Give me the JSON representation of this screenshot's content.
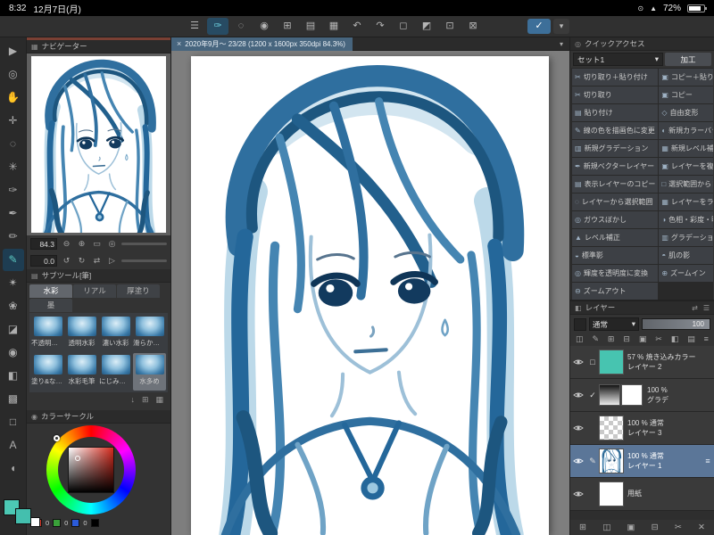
{
  "colors": {
    "main_color": "#4cc8b4",
    "layer_swatch": "#47c4b0",
    "selection_blue": "#5b7698",
    "tool_accent": "#5bc9c1",
    "confirm_blue": "#3d6f99"
  },
  "statusbar": {
    "time": "8:32",
    "date": "12月7日(月)",
    "battery_percent": "72%",
    "icons": [
      "⊙",
      "▲"
    ]
  },
  "toolbar": {
    "icons": [
      {
        "name": "main-menu-icon",
        "glyph": "☰"
      },
      {
        "name": "current-tool-icon",
        "glyph": "✑",
        "active": true
      },
      {
        "name": "marquee-icon",
        "glyph": "◌"
      },
      {
        "name": "lasso-icon",
        "glyph": "◉"
      },
      {
        "name": "canvas-settings-icon",
        "glyph": "⊞"
      },
      {
        "name": "save-icon",
        "glyph": "▤"
      },
      {
        "name": "export-icon",
        "glyph": "▦"
      },
      {
        "name": "undo-icon",
        "glyph": "↶"
      },
      {
        "name": "redo-icon",
        "glyph": "↷"
      },
      {
        "name": "select-all-icon",
        "glyph": "◻"
      },
      {
        "name": "invert-selection-icon",
        "glyph": "◩"
      },
      {
        "name": "deselect-icon",
        "glyph": "⊡"
      },
      {
        "name": "selection-launcher-icon",
        "glyph": "⊠"
      }
    ],
    "confirm_glyph": "✓",
    "chevron_glyph": "▾"
  },
  "tools": {
    "items": [
      {
        "name": "operation-tool",
        "glyph": "▶"
      },
      {
        "name": "zoom-tool",
        "glyph": "◎"
      },
      {
        "name": "hand-tool",
        "glyph": "✋"
      },
      {
        "name": "move-tool",
        "glyph": "✛"
      },
      {
        "name": "selection-tool",
        "glyph": "◌"
      },
      {
        "name": "auto-select-tool",
        "glyph": "✳"
      },
      {
        "name": "eyedropper-tool",
        "glyph": "✑"
      },
      {
        "name": "pen-tool",
        "glyph": "✒"
      },
      {
        "name": "pencil-tool",
        "glyph": "✏"
      },
      {
        "name": "brush-tool",
        "glyph": "✎",
        "selected": true
      },
      {
        "name": "airbrush-tool",
        "glyph": "✴"
      },
      {
        "name": "decoration-tool",
        "glyph": "❀"
      },
      {
        "name": "eraser-tool",
        "glyph": "◪"
      },
      {
        "name": "blend-tool",
        "glyph": "◉"
      },
      {
        "name": "fill-tool",
        "glyph": "◧"
      },
      {
        "name": "gradient-tool",
        "glyph": "▩"
      },
      {
        "name": "figure-tool",
        "glyph": "□"
      },
      {
        "name": "text-tool",
        "glyph": "A"
      },
      {
        "name": "balloon-tool",
        "glyph": "◖"
      }
    ]
  },
  "navigator": {
    "title": "ナビゲーター",
    "header_icon": "▦",
    "zoom_value": "84.3",
    "rotate_value": "0.0",
    "zoom_icons": [
      "⊖",
      "⊕",
      "▭",
      "◎"
    ],
    "rotate_icons": [
      "↺",
      "↻",
      "⇄",
      "▷"
    ]
  },
  "subtool": {
    "title": "サブツール[筆]",
    "header_icon": "▤",
    "tabs": [
      {
        "label": "水彩",
        "selected": true
      },
      {
        "label": "リアル"
      },
      {
        "label": "厚塗り"
      },
      {
        "label": "墨"
      }
    ],
    "brushes": [
      {
        "label": "不透明水彩"
      },
      {
        "label": "透明水彩"
      },
      {
        "label": "濃い水彩"
      },
      {
        "label": "滑らか水彩"
      },
      {
        "label": "塗り&なじませ"
      },
      {
        "label": "水彩毛筆"
      },
      {
        "label": "にじみ縁水彩"
      },
      {
        "label": "水多め",
        "selected": true
      }
    ],
    "footer_icons": [
      "↓",
      "⊞",
      "▦"
    ]
  },
  "colorwheel": {
    "title": "カラーサークル",
    "header_icon": "◉",
    "rgb_values": [
      "0",
      "0",
      "0"
    ]
  },
  "canvas": {
    "tab_title": "2020年9月〜 23/28 (1200 x 1600px 350dpi 84.3%)",
    "close_glyph": "×",
    "chevron_glyph": "▾"
  },
  "quickaccess": {
    "title": "クイックアクセス",
    "header_icon": "◎",
    "set_label": "セット1",
    "set_chevron": "▾",
    "mode_label": "加工",
    "items": [
      {
        "icon": "✂",
        "label": "切り取り＋貼り付け"
      },
      {
        "icon": "▣",
        "label": "コピー＋貼り付け"
      },
      {
        "icon": "✂",
        "label": "切り取り"
      },
      {
        "icon": "▣",
        "label": "コピー"
      },
      {
        "icon": "▤",
        "label": "貼り付け"
      },
      {
        "icon": "◇",
        "label": "自由変形"
      },
      {
        "icon": "✎",
        "label": "線の色を描画色に変更"
      },
      {
        "icon": "◐",
        "label": "新規カラーバランス"
      },
      {
        "icon": "▥",
        "label": "新規グラデーション"
      },
      {
        "icon": "▦",
        "label": "新規レベル補正"
      },
      {
        "icon": "✒",
        "label": "新規ベクターレイヤー"
      },
      {
        "icon": "▣",
        "label": "レイヤーを複製"
      },
      {
        "icon": "▤",
        "label": "表示レイヤーのコピー"
      },
      {
        "icon": "□",
        "label": "選択範囲からレイヤー"
      },
      {
        "icon": "◌",
        "label": "レイヤーから選択範囲"
      },
      {
        "icon": "▦",
        "label": "レイヤーをラスタライズ"
      },
      {
        "icon": "◎",
        "label": "ガウスぼかし"
      },
      {
        "icon": "◑",
        "label": "色相・彩度・明度"
      },
      {
        "icon": "▲",
        "label": "レベル補正"
      },
      {
        "icon": "▥",
        "label": "グラデーションマップ"
      },
      {
        "icon": "◒",
        "label": "標準影"
      },
      {
        "icon": "◓",
        "label": "肌の影"
      },
      {
        "icon": "◎",
        "label": "輝度を透明度に変換"
      },
      {
        "icon": "⊕",
        "label": "ズームイン"
      },
      {
        "icon": "⊖",
        "label": "ズームアウト"
      }
    ]
  },
  "layers": {
    "title": "レイヤー",
    "header_icon": "◧",
    "header_icons": [
      "⇄",
      "☰"
    ],
    "blend_label": "通常",
    "blend_chevron": "▾",
    "opacity_value": "100",
    "toolbar_icons": [
      "◫",
      "✎",
      "⊞",
      "⊟",
      "▣",
      "✂",
      "◧",
      "▤",
      "≡"
    ],
    "rows": [
      {
        "info": "57 % 焼き込みカラー",
        "name": "レイヤー 2",
        "aux": "□"
      },
      {
        "info": "100 %",
        "name": "グラデ",
        "aux": "✓"
      },
      {
        "info": "100 % 通常",
        "name": "レイヤー 3",
        "aux": ""
      },
      {
        "info": "100 % 通常",
        "name": "レイヤー 1",
        "aux": "✎",
        "selected": true
      },
      {
        "info": "",
        "name": "用紙",
        "aux": ""
      }
    ],
    "handle_glyph": "≡",
    "footer_icons": [
      "⊞",
      "◫",
      "▣",
      "⊟",
      "✂",
      "✕"
    ]
  }
}
